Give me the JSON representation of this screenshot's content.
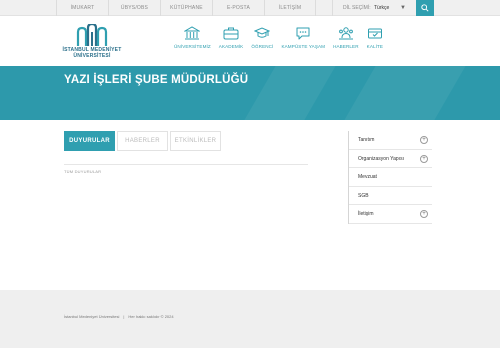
{
  "topbar": {
    "links": [
      "İMUKART",
      "ÜBYS/OBS",
      "KÜTÜPHANE",
      "E-POSTA",
      "İLETİŞİM"
    ],
    "lang_label": "DİL SEÇİMİ:",
    "lang_value": "Türkçe"
  },
  "logo": {
    "line1": "İSTANBUL MEDENİYET",
    "line2": "ÜNİVERSİTESİ"
  },
  "nav": [
    {
      "label": "ÜNİVERSİTEMİZ",
      "icon": "university-icon"
    },
    {
      "label": "AKADEMİK",
      "icon": "briefcase-icon"
    },
    {
      "label": "ÖĞRENCİ",
      "icon": "graduation-cap-icon"
    },
    {
      "label": "KAMPÜSTE YAŞAM",
      "icon": "chat-bubble-icon"
    },
    {
      "label": "HABERLER",
      "icon": "people-icon"
    },
    {
      "label": "KALİTE",
      "icon": "quality-box-icon"
    }
  ],
  "banner": {
    "title": "YAZI İŞLERİ ŞUBE MÜDÜRLÜĞÜ"
  },
  "tabs": [
    "DUYURULAR",
    "HABERLER",
    "ETKİNLİKLER"
  ],
  "all_announcements": "TÜM DUYURULAR",
  "sidebar": [
    {
      "label": "Tanıtım",
      "expandable": true
    },
    {
      "label": "Organizasyon Yapısı",
      "expandable": true
    },
    {
      "label": "Mevzuat",
      "expandable": false
    },
    {
      "label": "SGB",
      "expandable": false
    },
    {
      "label": "İletişim",
      "expandable": true
    }
  ],
  "footer": {
    "org": "İstanbul Medeniyet Üniversitesi",
    "rights": "Her hakkı saklıdır © 2024"
  },
  "colors": {
    "accent": "#2f9fb0",
    "banner": "#2d99ab",
    "logo_text": "#2a6f8a"
  }
}
